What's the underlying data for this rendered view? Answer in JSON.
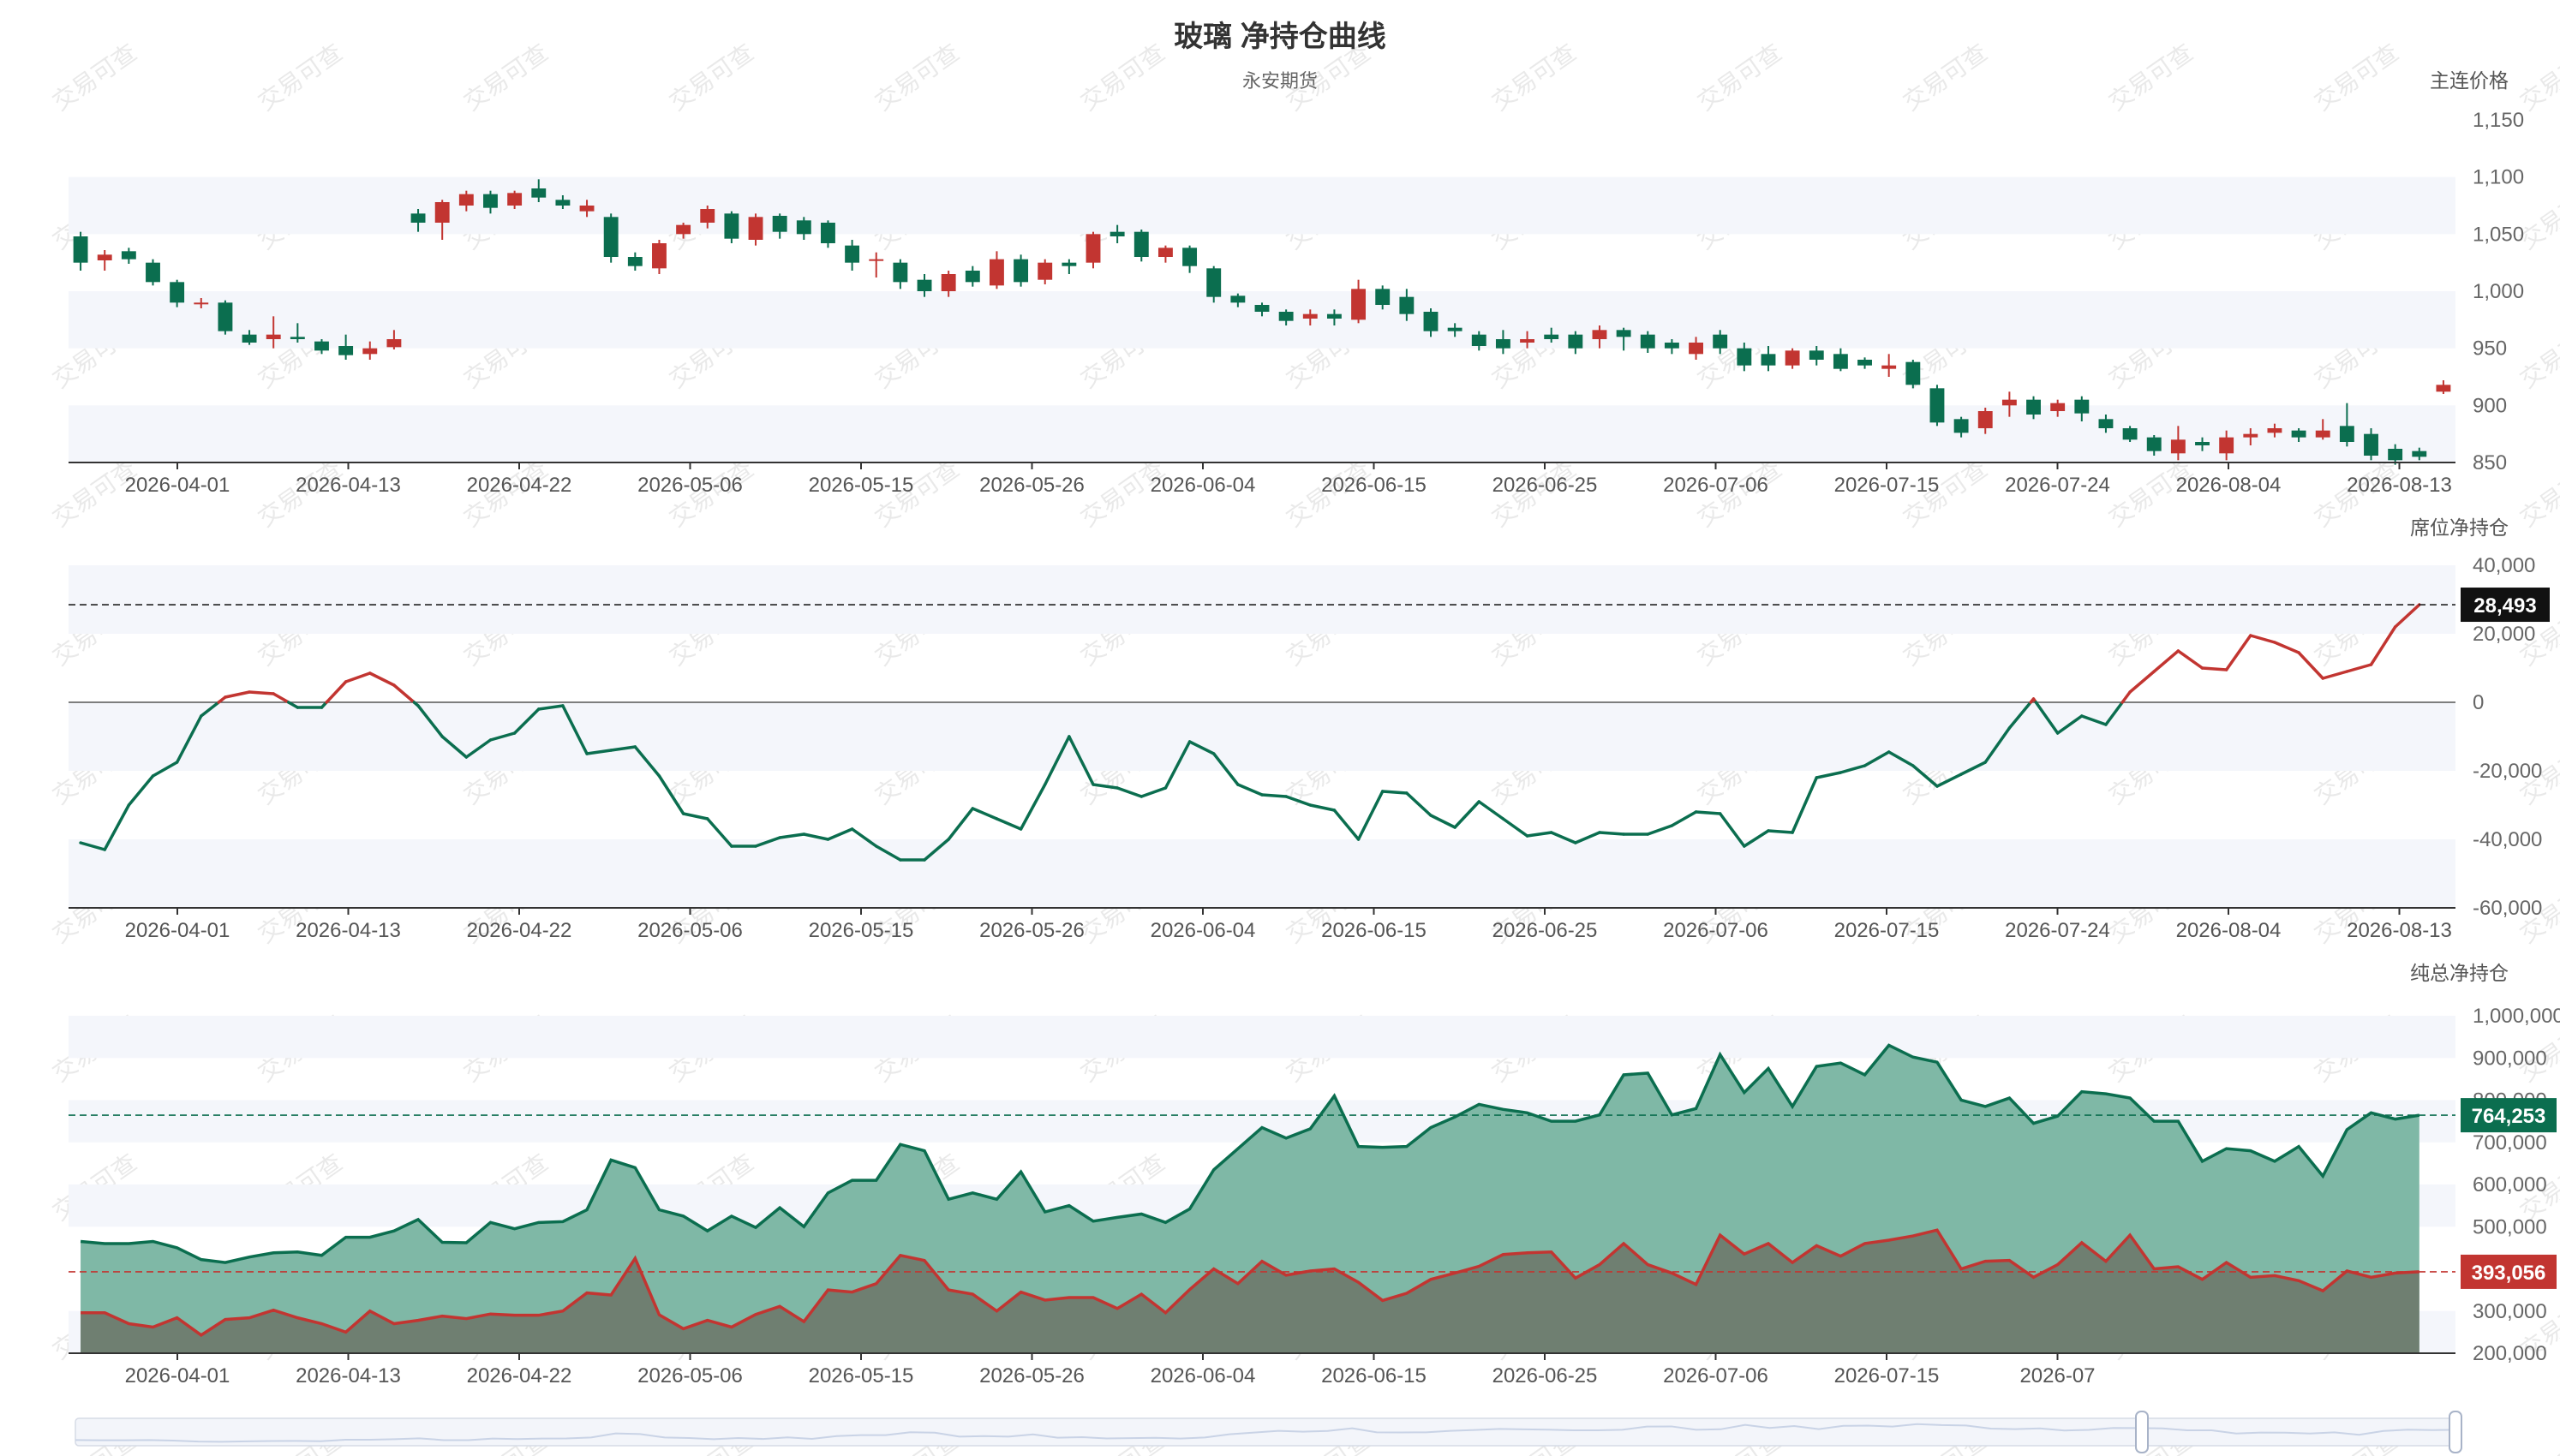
{
  "title": "玻璃 净持仓曲线",
  "subtitle": "永安期货",
  "watermark": "交易可查",
  "colors": {
    "up": "#c23531",
    "down": "#0b6e4f",
    "band": "#f4f6fb",
    "axis": "#333333"
  },
  "chart_data": [
    {
      "type": "candlestick",
      "name": "price",
      "y_axis_name": "主连价格",
      "x_labels": [
        "2026-04-01",
        "2026-04-13",
        "2026-04-22",
        "2026-05-06",
        "2026-05-15",
        "2026-05-26",
        "2026-06-04",
        "2026-06-15",
        "2026-06-25",
        "2026-07-06",
        "2026-07-15",
        "2026-07-24",
        "2026-08-04",
        "2026-08-13"
      ],
      "ylim": [
        850,
        1150
      ],
      "yticks": [
        "850",
        "900",
        "950",
        "1,000",
        "1,050",
        "1,100",
        "1,150"
      ],
      "ohlc": [
        [
          1048,
          1025,
          1018,
          1052
        ],
        [
          1027,
          1032,
          1018,
          1036
        ],
        [
          1035,
          1028,
          1024,
          1038
        ],
        [
          1025,
          1008,
          1005,
          1028
        ],
        [
          1008,
          990,
          986,
          1010
        ],
        [
          990,
          990,
          985,
          994
        ],
        [
          990,
          965,
          962,
          992
        ],
        [
          962,
          955,
          953,
          966
        ],
        [
          958,
          962,
          950,
          978
        ],
        [
          960,
          958,
          955,
          972
        ],
        [
          956,
          948,
          945,
          958
        ],
        [
          952,
          944,
          940,
          962
        ],
        [
          945,
          950,
          940,
          956
        ],
        [
          951,
          958,
          949,
          966
        ],
        [
          1068,
          1060,
          1052,
          1072
        ],
        [
          1060,
          1078,
          1045,
          1080
        ],
        [
          1075,
          1085,
          1070,
          1088
        ],
        [
          1085,
          1073,
          1068,
          1088
        ],
        [
          1075,
          1086,
          1072,
          1088
        ],
        [
          1090,
          1082,
          1078,
          1098
        ],
        [
          1080,
          1075,
          1072,
          1084
        ],
        [
          1070,
          1075,
          1065,
          1080
        ],
        [
          1065,
          1030,
          1025,
          1068
        ],
        [
          1030,
          1022,
          1018,
          1034
        ],
        [
          1020,
          1042,
          1015,
          1045
        ],
        [
          1050,
          1058,
          1046,
          1060
        ],
        [
          1060,
          1072,
          1055,
          1075
        ],
        [
          1068,
          1046,
          1042,
          1070
        ],
        [
          1045,
          1065,
          1040,
          1068
        ],
        [
          1066,
          1052,
          1046,
          1068
        ],
        [
          1062,
          1050,
          1045,
          1065
        ],
        [
          1060,
          1042,
          1038,
          1062
        ],
        [
          1040,
          1025,
          1018,
          1045
        ],
        [
          1028,
          1028,
          1012,
          1034
        ],
        [
          1025,
          1008,
          1002,
          1028
        ],
        [
          1010,
          1000,
          995,
          1015
        ],
        [
          1000,
          1015,
          995,
          1018
        ],
        [
          1018,
          1008,
          1004,
          1022
        ],
        [
          1005,
          1028,
          1002,
          1035
        ],
        [
          1028,
          1008,
          1004,
          1032
        ],
        [
          1010,
          1025,
          1006,
          1028
        ],
        [
          1025,
          1022,
          1015,
          1028
        ],
        [
          1025,
          1050,
          1020,
          1052
        ],
        [
          1052,
          1048,
          1042,
          1058
        ],
        [
          1052,
          1030,
          1026,
          1054
        ],
        [
          1030,
          1038,
          1025,
          1040
        ],
        [
          1038,
          1022,
          1016,
          1040
        ],
        [
          1020,
          995,
          990,
          1022
        ],
        [
          996,
          990,
          986,
          998
        ],
        [
          988,
          982,
          978,
          990
        ],
        [
          982,
          974,
          970,
          984
        ],
        [
          976,
          980,
          970,
          984
        ],
        [
          980,
          976,
          970,
          984
        ],
        [
          975,
          1002,
          972,
          1010
        ],
        [
          1002,
          988,
          984,
          1005
        ],
        [
          995,
          980,
          974,
          1002
        ],
        [
          982,
          965,
          960,
          985
        ],
        [
          968,
          965,
          960,
          972
        ],
        [
          962,
          952,
          948,
          965
        ],
        [
          958,
          950,
          945,
          966
        ],
        [
          955,
          958,
          950,
          965
        ],
        [
          962,
          958,
          955,
          968
        ],
        [
          962,
          950,
          945,
          965
        ],
        [
          958,
          966,
          950,
          970
        ],
        [
          966,
          960,
          948,
          968
        ],
        [
          962,
          950,
          946,
          965
        ],
        [
          955,
          950,
          945,
          958
        ],
        [
          945,
          955,
          940,
          960
        ],
        [
          962,
          950,
          945,
          966
        ],
        [
          950,
          935,
          930,
          955
        ],
        [
          945,
          935,
          930,
          952
        ],
        [
          935,
          948,
          932,
          950
        ],
        [
          948,
          940,
          935,
          952
        ],
        [
          945,
          932,
          930,
          950
        ],
        [
          940,
          935,
          932,
          942
        ],
        [
          932,
          935,
          925,
          945
        ],
        [
          938,
          918,
          915,
          940
        ],
        [
          915,
          885,
          882,
          918
        ],
        [
          888,
          876,
          872,
          890
        ],
        [
          880,
          895,
          875,
          898
        ],
        [
          900,
          905,
          890,
          912
        ],
        [
          905,
          892,
          888,
          908
        ],
        [
          895,
          902,
          890,
          905
        ],
        [
          905,
          893,
          886,
          908
        ],
        [
          888,
          880,
          876,
          892
        ],
        [
          880,
          870,
          868,
          882
        ],
        [
          872,
          860,
          856,
          874
        ],
        [
          858,
          870,
          852,
          882
        ],
        [
          868,
          865,
          860,
          872
        ],
        [
          858,
          872,
          852,
          878
        ],
        [
          872,
          875,
          865,
          880
        ],
        [
          876,
          880,
          872,
          884
        ],
        [
          878,
          872,
          868,
          880
        ],
        [
          872,
          878,
          870,
          888
        ],
        [
          882,
          868,
          864,
          902
        ],
        [
          875,
          856,
          852,
          880
        ],
        [
          862,
          852,
          848,
          866
        ],
        [
          860,
          855,
          852,
          863
        ],
        [
          912,
          918,
          910,
          922
        ]
      ]
    },
    {
      "type": "line",
      "name": "seat_net",
      "y_axis_name": "席位净持仓",
      "x_labels": [
        "2026-04-01",
        "2026-04-13",
        "2026-04-22",
        "2026-05-06",
        "2026-05-15",
        "2026-05-26",
        "2026-06-04",
        "2026-06-15",
        "2026-06-25",
        "2026-07-06",
        "2026-07-15",
        "2026-07-24",
        "2026-08-04",
        "2026-08-13"
      ],
      "ylim": [
        -60000,
        40000
      ],
      "yticks": [
        "-60,000",
        "-40,000",
        "-20,000",
        "0",
        "20,000",
        "40,000"
      ],
      "marker_label": "28,493",
      "values": [
        -41000,
        -43000,
        -30000,
        -21500,
        -17500,
        -4000,
        1500,
        3000,
        2500,
        -1500,
        -1500,
        6000,
        8500,
        5000,
        -1000,
        -10000,
        -16000,
        -11000,
        -9000,
        -2000,
        -1000,
        -15000,
        -14000,
        -13000,
        -21500,
        -32500,
        -34000,
        -42000,
        -42000,
        -39500,
        -38500,
        -40000,
        -37000,
        -42000,
        -46000,
        -46000,
        -40000,
        -31000,
        -34000,
        -37000,
        -24000,
        -10000,
        -24000,
        -25000,
        -27500,
        -25000,
        -11500,
        -15000,
        -24000,
        -27000,
        -27500,
        -30000,
        -31500,
        -40000,
        -26000,
        -26500,
        -33000,
        -36500,
        -29000,
        -34000,
        -39000,
        -38000,
        -41000,
        -38000,
        -38500,
        -38500,
        -36000,
        -32000,
        -32500,
        -42000,
        -37500,
        -38000,
        -22000,
        -20500,
        -18500,
        -14500,
        -18500,
        -24500,
        -21000,
        -17500,
        -7500,
        1000,
        -9000,
        -4000,
        -6500,
        3000,
        9000,
        15000,
        10000,
        9500,
        19500,
        17500,
        14500,
        7000,
        9000,
        11000,
        22000,
        28493
      ]
    },
    {
      "type": "area",
      "name": "total_net",
      "y_axis_name": "纯总净持仓",
      "x_labels": [
        "2026-04-01",
        "2026-04-13",
        "2026-04-22",
        "2026-05-06",
        "2026-05-15",
        "2026-05-26",
        "2026-06-04",
        "2026-06-15",
        "2026-06-25",
        "2026-07-06",
        "2026-07-15",
        "2026-07"
      ],
      "ylim": [
        200000,
        1000000
      ],
      "yticks": [
        "200,000",
        "300,000",
        "500,000",
        "600,000",
        "700,000",
        "800,000",
        "900,000",
        "1,000,000"
      ],
      "marker_labels": [
        "764,253",
        "393,056"
      ],
      "series": [
        {
          "values": [
            465000,
            460000,
            460000,
            465000,
            450000,
            422000,
            415000,
            428000,
            438000,
            440000,
            432000,
            475000,
            475000,
            490000,
            517000,
            463000,
            462000,
            510000,
            495000,
            510000,
            512000,
            540000,
            658000,
            640000,
            540000,
            525000,
            490000,
            525000,
            498000,
            545000,
            500000,
            580000,
            610000,
            610000,
            695000,
            680000,
            565000,
            580000,
            565000,
            630000,
            535000,
            550000,
            513000,
            522000,
            530000,
            510000,
            542000,
            635000,
            685000,
            735000,
            710000,
            732000,
            810000,
            690000,
            688000,
            690000,
            735000,
            760000,
            790000,
            778000,
            770000,
            750000,
            750000,
            765000,
            860000,
            864000,
            765000,
            780000,
            908000,
            818000,
            875000,
            785000,
            880000,
            888000,
            860000,
            930000,
            902000,
            890000,
            800000,
            785000,
            805000,
            745000,
            762000,
            820000,
            815000,
            805000,
            750000,
            750000,
            655000,
            685000,
            680000,
            655000,
            690000,
            620000,
            730000,
            770000,
            755000,
            764253
          ]
        },
        {
          "values": [
            296000,
            296000,
            270000,
            262000,
            284000,
            243000,
            280000,
            284000,
            302000,
            284000,
            270000,
            250000,
            300000,
            270000,
            278000,
            288000,
            282000,
            293000,
            290000,
            290000,
            300000,
            343000,
            338000,
            425000,
            291000,
            258000,
            278000,
            262000,
            292000,
            311000,
            275000,
            350000,
            345000,
            365000,
            432000,
            420000,
            350000,
            340000,
            300000,
            345000,
            326000,
            332000,
            332000,
            306000,
            340000,
            296000,
            351000,
            400000,
            365000,
            418000,
            385000,
            395000,
            400000,
            368000,
            325000,
            342000,
            375000,
            390000,
            406000,
            434000,
            438000,
            440000,
            378000,
            410000,
            460000,
            410000,
            390000,
            363000,
            480000,
            435000,
            460000,
            415000,
            455000,
            430000,
            460000,
            468000,
            478000,
            492000,
            400000,
            418000,
            420000,
            380000,
            410000,
            462000,
            418000,
            480000,
            400000,
            405000,
            375000,
            415000,
            380000,
            384000,
            372000,
            348000,
            395000,
            380000,
            390000,
            393056
          ]
        }
      ]
    }
  ]
}
